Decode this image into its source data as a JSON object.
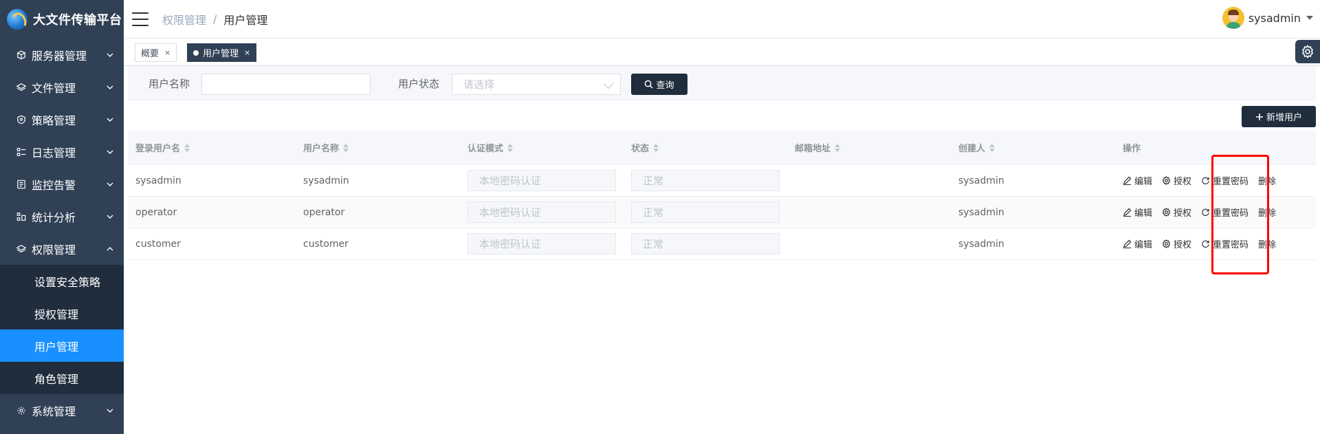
{
  "app": {
    "title": "大文件传输平台"
  },
  "sidebar": {
    "items": [
      {
        "label": "服务器管理",
        "icon": "cube-icon"
      },
      {
        "label": "文件管理",
        "icon": "layers-icon"
      },
      {
        "label": "策略管理",
        "icon": "shield-icon"
      },
      {
        "label": "日志管理",
        "icon": "list-icon"
      },
      {
        "label": "监控告警",
        "icon": "monitor-icon"
      },
      {
        "label": "统计分析",
        "icon": "chart-icon"
      },
      {
        "label": "权限管理",
        "icon": "layers-icon",
        "expanded": true
      },
      {
        "label": "系统管理",
        "icon": "gear-icon"
      }
    ],
    "subitems": [
      {
        "label": "设置安全策略"
      },
      {
        "label": "授权管理"
      },
      {
        "label": "用户管理",
        "active": true
      },
      {
        "label": "角色管理"
      }
    ]
  },
  "header": {
    "breadcrumb": [
      "权限管理",
      "用户管理"
    ],
    "separator": "/",
    "username": "sysadmin"
  },
  "tags": [
    {
      "label": "概要",
      "close": "×"
    },
    {
      "label": "用户管理",
      "close": "×",
      "active": true
    }
  ],
  "search": {
    "username_label": "用户名称",
    "username_value": "",
    "status_label": "用户状态",
    "status_placeholder": "请选择",
    "query_label": "查询"
  },
  "toolbar": {
    "add_label": "新增用户"
  },
  "table": {
    "columns": [
      "登录用户名",
      "用户名称",
      "认证模式",
      "状态",
      "邮箱地址",
      "创建人",
      "操作"
    ],
    "rows": [
      {
        "login": "sysadmin",
        "name": "sysadmin",
        "auth": "本地密码认证",
        "status": "正常",
        "email": "",
        "creator": "sysadmin"
      },
      {
        "login": "operator",
        "name": "operator",
        "auth": "本地密码认证",
        "status": "正常",
        "email": "",
        "creator": "sysadmin"
      },
      {
        "login": "customer",
        "name": "customer",
        "auth": "本地密码认证",
        "status": "正常",
        "email": "",
        "creator": "sysadmin"
      }
    ],
    "actions": {
      "edit": "编辑",
      "authorize": "授权",
      "reset": "重置密码",
      "delete": "删除"
    }
  },
  "colors": {
    "sidebar_bg": "#304156",
    "active_menu": "#1890ff",
    "dark_button": "#1f2d3d",
    "highlight": "#ff0000"
  }
}
